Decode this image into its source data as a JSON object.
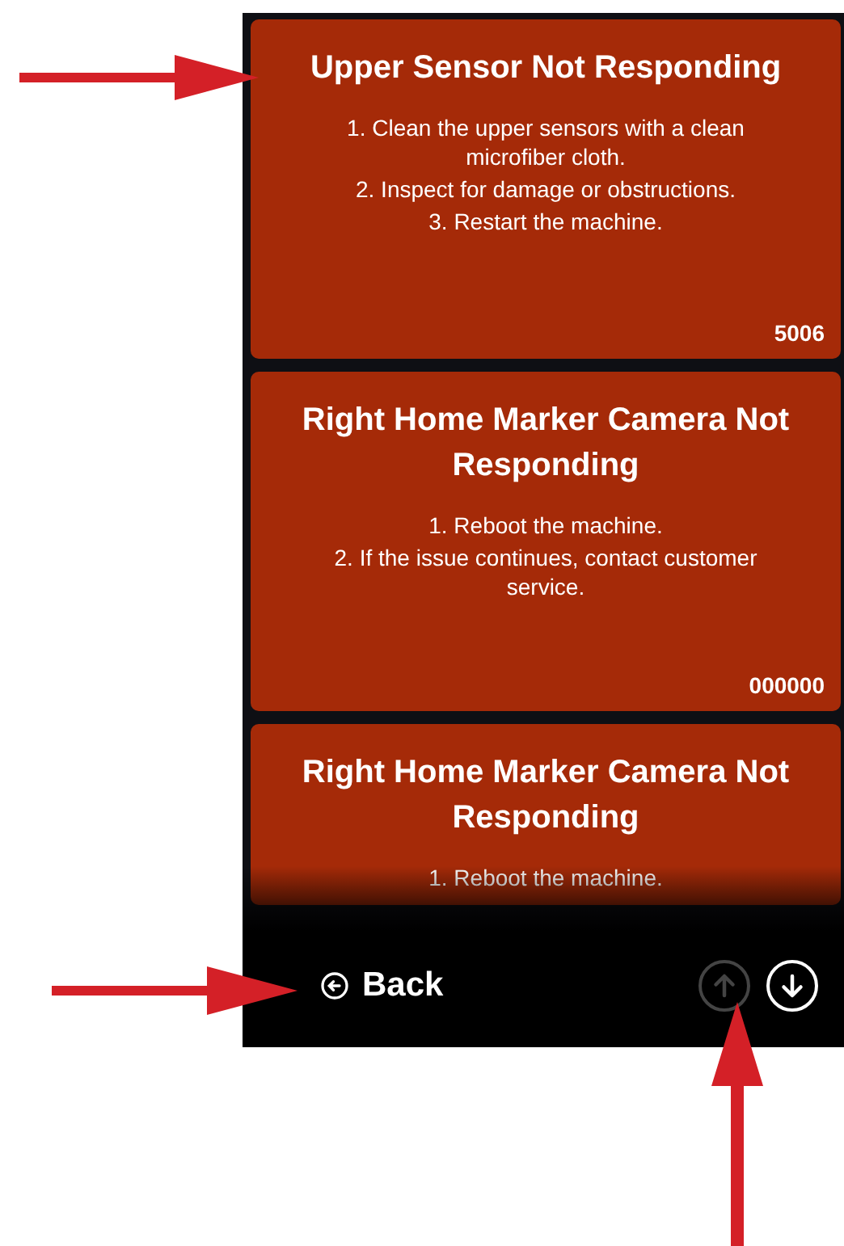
{
  "alerts": [
    {
      "title": "Upper Sensor Not Responding",
      "steps": [
        "1. Clean the upper sensors with a clean microfiber cloth.",
        "2. Inspect for damage or obstructions.",
        "3. Restart the machine."
      ],
      "code": "5006"
    },
    {
      "title": "Right Home Marker Camera Not Responding",
      "steps": [
        "1. Reboot the machine.",
        "2. If the issue continues, contact customer service."
      ],
      "code": "000000"
    },
    {
      "title": "Right Home Marker Camera Not Responding",
      "steps": [
        "1. Reboot the machine."
      ]
    }
  ],
  "bottom_bar": {
    "back": {
      "label": "Back"
    },
    "scroll_buttons": [
      {
        "kind": "up",
        "disabled": true
      },
      {
        "kind": "down",
        "disabled": false
      }
    ]
  }
}
